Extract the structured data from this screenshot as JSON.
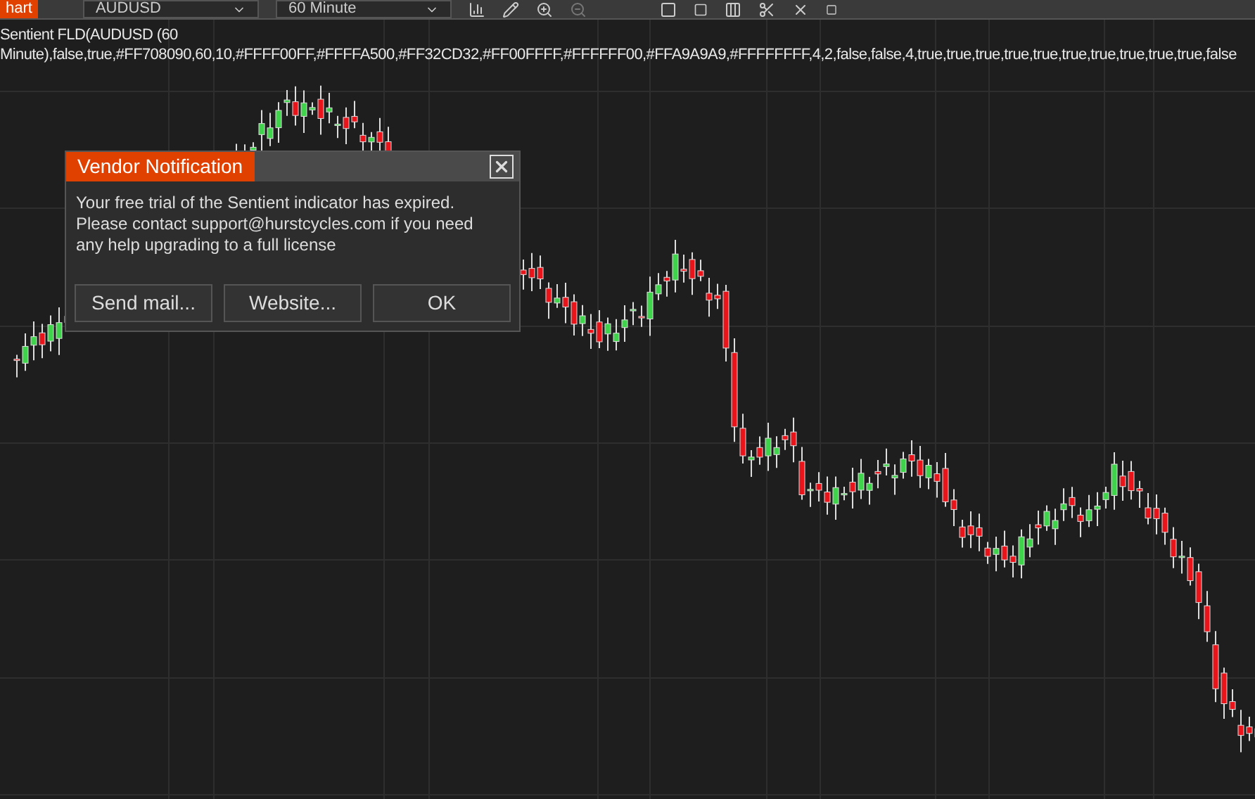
{
  "toolbar": {
    "chart_button": "hart",
    "instrument": "AUDUSD",
    "interval": "60 Minute"
  },
  "indicator_label": "Sentient FLD(AUDUSD (60 Minute),false,true,#FF708090,60,10,#FFFF00FF,#FFFFA500,#FF32CD32,#FF00FFFF,#FFFFFF00,#FFA9A9A9,#FFFFFFFF,4,2,false,false,4,true,true,true,true,true,true,true,true,true,true,false",
  "dialog": {
    "title": "Vendor Notification",
    "message": "Your free trial of the Sentient indicator has expired.\nPlease contact support@hurstcycles.com if you need\nany help upgrading to a full license",
    "buttons": [
      "Send mail...",
      "Website...",
      "OK"
    ]
  }
}
